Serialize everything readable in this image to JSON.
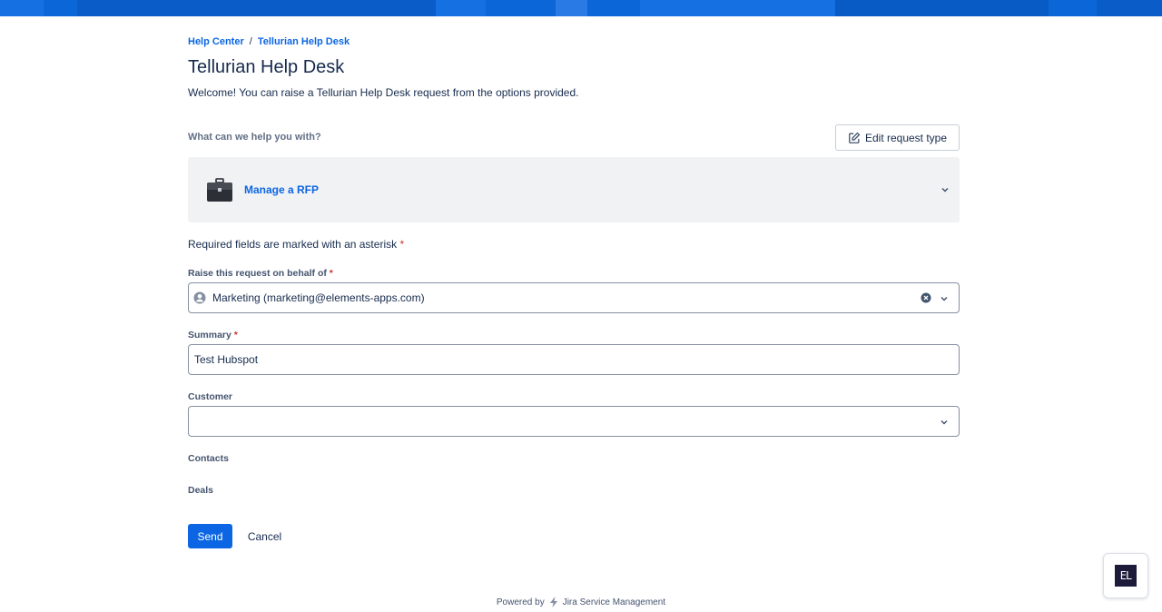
{
  "banner": {
    "colors": [
      "#0b66d8",
      "#0a5dc8",
      "#1570e2",
      "#085bc4"
    ]
  },
  "breadcrumb": {
    "items": [
      "Help Center",
      "Tellurian Help Desk"
    ],
    "separator": "/"
  },
  "page": {
    "title": "Tellurian Help Desk",
    "welcome": "Welcome! You can raise a Tellurian Help Desk request from the options provided."
  },
  "request_type": {
    "section_label": "What can we help you with?",
    "edit_button_label": "Edit request type",
    "edit_icon": "edit-icon",
    "selected_label": "Manage a RFP",
    "selected_icon": "briefcase-icon"
  },
  "form": {
    "required_note": "Required fields are marked with an asterisk",
    "asterisk": "*",
    "on_behalf_label": "Raise this request on behalf of",
    "on_behalf_value": "Marketing (marketing@elements-apps.com)",
    "summary_label": "Summary",
    "summary_value": "Test Hubspot",
    "customer_label": "Customer",
    "customer_value": "",
    "contacts_label": "Contacts",
    "deals_label": "Deals",
    "send_label": "Send",
    "cancel_label": "Cancel"
  },
  "footer": {
    "powered_by": "Powered by",
    "product": "Jira Service Management"
  },
  "widget": {
    "logo_text": "EL"
  },
  "colors": {
    "primary": "#0c66e4",
    "text": "#172b4d",
    "required": "#c9372c"
  }
}
